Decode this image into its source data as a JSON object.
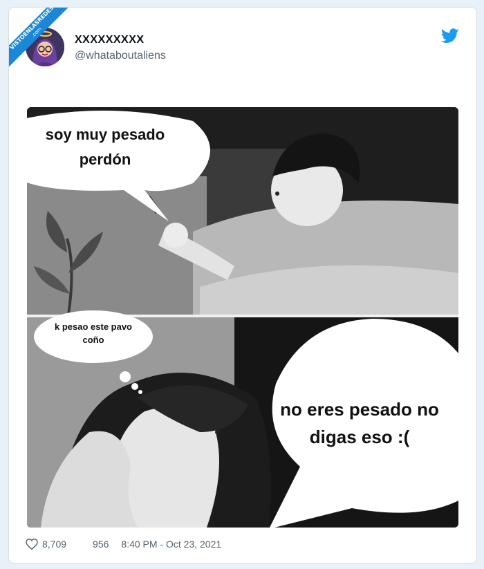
{
  "watermark": {
    "line1": "VISTOENLASREDES",
    "line2": ".com"
  },
  "tweet": {
    "display_name": "XXXXXXXXX",
    "handle": "@whataboutaliens",
    "likes": "8,709",
    "replies": "956",
    "timestamp": "8:40 PM - Oct 23, 2021"
  },
  "comic": {
    "boy_bubble": "soy muy pesado perdón",
    "thought_bubble": "k pesao este pavo coño",
    "girl_bubble": "no eres pesado no digas eso :("
  },
  "colors": {
    "twitter_blue": "#1d9bf0",
    "ribbon_blue": "#1b87d6",
    "heart_outline": "#536471"
  },
  "icons": [
    "twitter-bird-icon",
    "heart-icon",
    "avatar-illustration"
  ]
}
